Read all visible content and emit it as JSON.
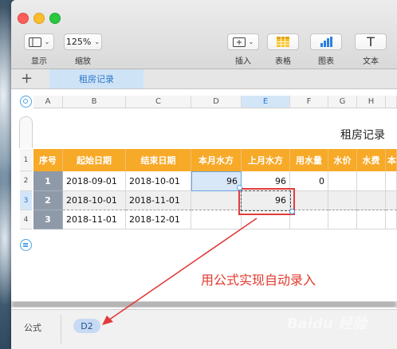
{
  "toolbar": {
    "view": {
      "label": "显示"
    },
    "zoom": {
      "value": "125%",
      "label": "缩放"
    },
    "insert": {
      "label": "插入"
    },
    "table": {
      "label": "表格"
    },
    "chart": {
      "label": "图表"
    },
    "text": {
      "label": "文本",
      "glyph": "T"
    }
  },
  "tabs": {
    "add": "+",
    "sheet": "租房记录"
  },
  "columns": [
    "A",
    "B",
    "C",
    "D",
    "E",
    "F",
    "G",
    "H"
  ],
  "rows": [
    "1",
    "2",
    "3",
    "4"
  ],
  "table": {
    "title": "租房记录",
    "headers": [
      "序号",
      "起始日期",
      "结束日期",
      "本月水方",
      "上月水方",
      "用水量",
      "水价",
      "水费",
      "本"
    ],
    "data": [
      {
        "idx": "1",
        "start": "2018-09-01",
        "end": "2018-10-01",
        "cur": "96",
        "prev": "96",
        "usage": "0"
      },
      {
        "idx": "2",
        "start": "2018-10-01",
        "end": "2018-11-01",
        "cur": "",
        "prev": "96",
        "usage": ""
      },
      {
        "idx": "3",
        "start": "2018-11-01",
        "end": "2018-12-01",
        "cur": "",
        "prev": "",
        "usage": ""
      }
    ]
  },
  "annotation": "用公式实现自动录入",
  "formula_bar": {
    "label": "公式",
    "cell_ref": "D2"
  },
  "watermark": "Baidu 经验",
  "colors": {
    "header_orange": "#f7a928",
    "index_gray": "#8e9aa8",
    "accent_blue": "#2a77c9",
    "annotation_red": "#e03a2f"
  }
}
